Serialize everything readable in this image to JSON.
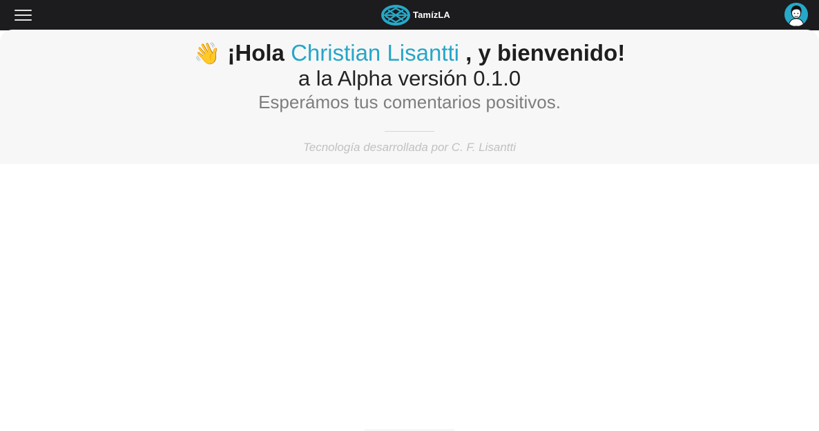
{
  "header": {
    "menu_icon": "hamburger-menu-icon",
    "brand_icon": "tamizla-logo-icon",
    "brand_name": "TamízLA",
    "avatar_icon": "user-avatar-icon",
    "background_color": "#1c1c1e"
  },
  "hero": {
    "wave_emoji": "👋",
    "greeting_prefix": "¡Hola ",
    "user_name": "Christian Lisantti",
    "greeting_suffix": " , y bienvenido!",
    "version_text": "a la Alpha versión 0.1.0",
    "subtitle": "Esperámos tus comentarios positivos.",
    "credit": "Tecnología desarrollada por C. F. Lisantti",
    "accent_color": "#27a6c7",
    "background_color": "#f7f7f7"
  }
}
